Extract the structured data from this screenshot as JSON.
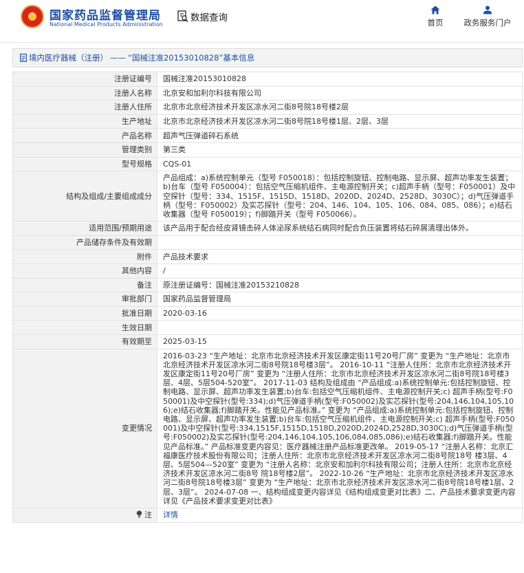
{
  "header": {
    "logo_cn": "国家药品监督管理局",
    "logo_en": "National Medical Products Administration",
    "data_query": "数据查询",
    "nav": [
      {
        "label": "首页",
        "icon": "home-icon"
      },
      {
        "label": "政务服务门户",
        "icon": "user-icon"
      }
    ]
  },
  "breadcrumb": {
    "category": "境内医疗器械（注册）",
    "separator": "——",
    "record_title": "“国械注准20153010828”基本信息"
  },
  "fields": [
    {
      "label": "注册证编号",
      "value": "国械注准20153010828"
    },
    {
      "label": "注册人名称",
      "value": "北京安和加利尔科技有限公司"
    },
    {
      "label": "注册人住所",
      "value": "北京市北京经济技术开发区凉水河二街8号院18号楼2层"
    },
    {
      "label": "生产地址",
      "value": "北京市北京经济技术开发区凉水河二街8号院18号楼1层、2层、3层"
    },
    {
      "label": "产品名称",
      "value": "超声气压弹道碎石系统"
    },
    {
      "label": "管理类别",
      "value": "第三类"
    },
    {
      "label": "型号规格",
      "value": "CQS-01"
    },
    {
      "label": "结构及组成/主要组成成分",
      "value": "产品组成：a)系统控制单元（型号 F050018）：包括控制旋钮、控制电路、显示屏、超声功率发生装置；b)台车（型号 F050004）：包括空气压缩机组件、主电源控制开关；c)超声手柄（型号：F050001）及中空探针（型号：334、1515F、1515D、1518D、2020D、2024D、2528D、3030C）；d)气压弹道手柄（型号：F050002）及实芯探针（型号：204、146、104、105、106、084、085、086）；e)结石收集器（型号 F050019）；f)脚踏开关（型号 F050066）。"
    },
    {
      "label": "适用范围/预期用途",
      "value": "该产品用于配合经皮肾镜击碎人体泌尿系统结石病同时配合负压装置将结石碎屑清理出体外。"
    },
    {
      "label": "产品储存条件及有效期",
      "value": ""
    },
    {
      "label": "附件",
      "value": "产品技术要求"
    },
    {
      "label": "其他内容",
      "value": "/"
    },
    {
      "label": "备注",
      "value": "原注册证编号：国械注准20153210828"
    },
    {
      "label": "审批部门",
      "value": "国家药品监督管理局"
    },
    {
      "label": "批准日期",
      "value": "2020-03-16"
    },
    {
      "label": "生效日期",
      "value": ""
    },
    {
      "label": "有效期至",
      "value": "2025-03-15"
    },
    {
      "label": "变更情况",
      "value": "2016-03-23 “生产地址：北京市北京经济技术开发区康定街11号20号厂房” 变更为 “生产地址：北京市北京经济技术开发区凉水河二街8号院18号楼3层”。 2016-10-11 “注册人住所：北京市北京经济技术开发区康定街11号20号厂房” 变更为 “注册人住所：北京市北京经济技术开发区凉水河二街8号院18号楼3层、4层、5层504-520室”。 2017-11-03 结构及组成由 “产品组成:a)系统控制单元:包括控制旋钮、控制电路、显示屏、超声功率发生装置;b)台车:包括空气压缩机组件、主电源控制开关;c) 超声手柄(型号:F050001)及中空探针(型号:334);d)气压弹道手柄(型号:F050002)及实芯探针(型号:204,146,104,105,106);e)结石收集器;f)脚踏开关。性能见产品标准。” 变更为 “产品组成:a)系统控制单元:包括控制旋钮、控制电路、显示屏、超声功率发生装置;b)台车:包括空气压缩机组件、主电源控制开关;c) 超声手柄(型号:F050001)及中空探针(型号:334,1515F,1515D,1518D,2020D,2024D,2528D,3030C);d)气压弹道手柄(型号:F050002)及实芯探针(型号:204,146,104,105,106,084,085,086);e)结石收集器;f)脚踏开关。性能见产品标准。” 产品标准变更内容见：医疗器械注册产品标准更改单。 2019-05-17 “注册人名称：北京汇福康医疗技术股份有限公司；注册人住所：北京市北京经济技术开发区凉水河二街8号院18号 楼3层、4层、5层504—520室” 变更为 “注册人名称：北京安和加利尔科技有限公司；注册人住所：北京市北京经济技术开发区凉水河二街8号 院18号楼2层”。 2022-10-26 “生产地址：北京市北京经济技术开发区凉水河二街8号院18号楼3层” 变更为 “生产地址：北京市北京经济技术开发区凉水河二街8号院18号楼1层、2层、3层”。 2024-07-08 一、结构组成变更内容详见《结构组成变更对比表》二、产品技术要求变更内容详见《产品技术要求变更对比表》"
    },
    {
      "label": "注",
      "value": "详情",
      "icon": "lightbulb-icon"
    }
  ]
}
